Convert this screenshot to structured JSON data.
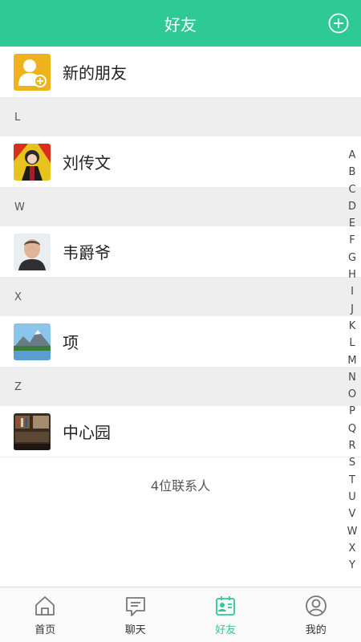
{
  "header": {
    "title": "好友",
    "add_icon": "plus-circle-icon"
  },
  "new_friends": {
    "label": "新的朋友",
    "icon": "add-user-icon",
    "color": "#f0b21b"
  },
  "sections": [
    {
      "letter": "L",
      "contacts": [
        {
          "name": "刘传文"
        }
      ]
    },
    {
      "letter": "W",
      "contacts": [
        {
          "name": "韦爵爷"
        }
      ]
    },
    {
      "letter": "X",
      "contacts": [
        {
          "name": "项"
        }
      ]
    },
    {
      "letter": "Z",
      "contacts": [
        {
          "name": "中心园"
        }
      ]
    }
  ],
  "contact_count": "4位联系人",
  "index_letters": [
    "A",
    "B",
    "C",
    "D",
    "E",
    "F",
    "G",
    "H",
    "I",
    "J",
    "K",
    "L",
    "M",
    "N",
    "O",
    "P",
    "Q",
    "R",
    "S",
    "T",
    "U",
    "V",
    "W",
    "X",
    "Y"
  ],
  "tabbar": {
    "tabs": [
      {
        "label": "首页",
        "icon": "home-icon",
        "active": false
      },
      {
        "label": "聊天",
        "icon": "chat-icon",
        "active": false
      },
      {
        "label": "好友",
        "icon": "contacts-icon",
        "active": true
      },
      {
        "label": "我的",
        "icon": "profile-icon",
        "active": false
      }
    ]
  },
  "colors": {
    "accent": "#2ec995",
    "section_bg": "#eeeeee"
  }
}
